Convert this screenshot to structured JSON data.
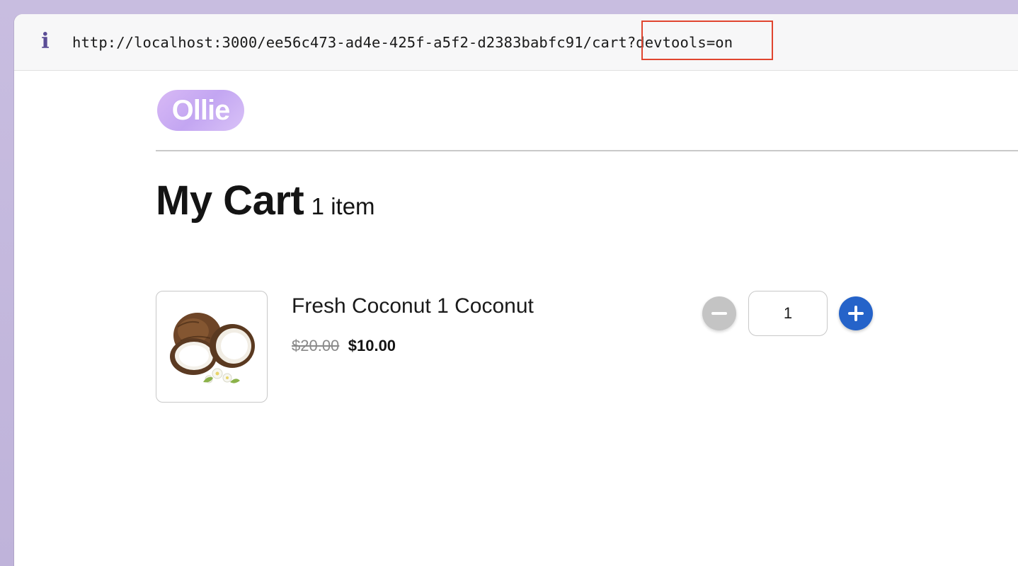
{
  "browser": {
    "info_icon": "info-icon",
    "url": "http://localhost:3000/ee56c473-ad4e-425f-a5f2-d2383babfc91/cart?devtools=on"
  },
  "header": {
    "logo_text": "Ollie"
  },
  "cart": {
    "title": "My Cart",
    "item_count": "1 item",
    "items": [
      {
        "name": "Fresh Coconut 1 Coconut",
        "image_icon": "coconut-image",
        "original_price": "$20.00",
        "sale_price": "$10.00",
        "quantity": "1"
      }
    ]
  },
  "colors": {
    "accent": "#2563c9",
    "highlight": "#e0452f",
    "disabled": "#c4c4c4",
    "logo": "#c3a6f2"
  }
}
